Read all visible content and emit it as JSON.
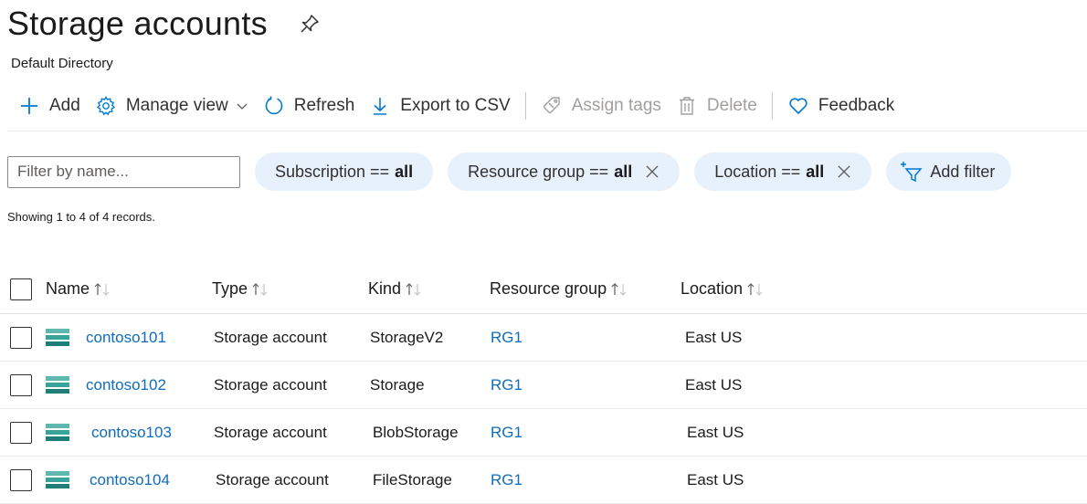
{
  "header": {
    "title": "Storage accounts",
    "subtitle": "Default Directory"
  },
  "toolbar": {
    "add_label": "Add",
    "manage_view_label": "Manage view",
    "refresh_label": "Refresh",
    "export_label": "Export to CSV",
    "assign_tags_label": "Assign tags",
    "delete_label": "Delete",
    "feedback_label": "Feedback"
  },
  "filters": {
    "name_placeholder": "Filter by name...",
    "subscription": {
      "label": "Subscription ==",
      "value": "all"
    },
    "resource_group": {
      "label": "Resource group ==",
      "value": "all"
    },
    "location": {
      "label": "Location ==",
      "value": "all"
    },
    "add_filter_label": "Add filter"
  },
  "records_text": "Showing 1 to 4 of 4 records.",
  "columns": {
    "name": "Name",
    "type": "Type",
    "kind": "Kind",
    "resource_group": "Resource group",
    "location": "Location"
  },
  "rows": [
    {
      "name": "contoso101",
      "type": "Storage account",
      "kind": "StorageV2",
      "resource_group": "RG1",
      "location": "East US"
    },
    {
      "name": "contoso102",
      "type": "Storage account",
      "kind": "Storage",
      "resource_group": "RG1",
      "location": "East US"
    },
    {
      "name": "contoso103",
      "type": "Storage account",
      "kind": "BlobStorage",
      "resource_group": "RG1",
      "location": "East US"
    },
    {
      "name": "contoso104",
      "type": "Storage account",
      "kind": "FileStorage",
      "resource_group": "RG1",
      "location": "East US"
    }
  ],
  "colors": {
    "link": "#0f6cbd",
    "accent": "#0078d4",
    "pill_bg": "#e6f1fb",
    "storage_icon": "#3aa39a"
  },
  "icons": {
    "pin": "pin-icon",
    "add": "plus-icon",
    "manage_view": "gear-icon",
    "refresh": "refresh-icon",
    "export": "download-icon",
    "assign_tags": "tag-icon",
    "delete": "trash-icon",
    "feedback": "heart-icon",
    "add_filter": "filter-plus-icon",
    "storage_account": "storage-account-icon"
  }
}
